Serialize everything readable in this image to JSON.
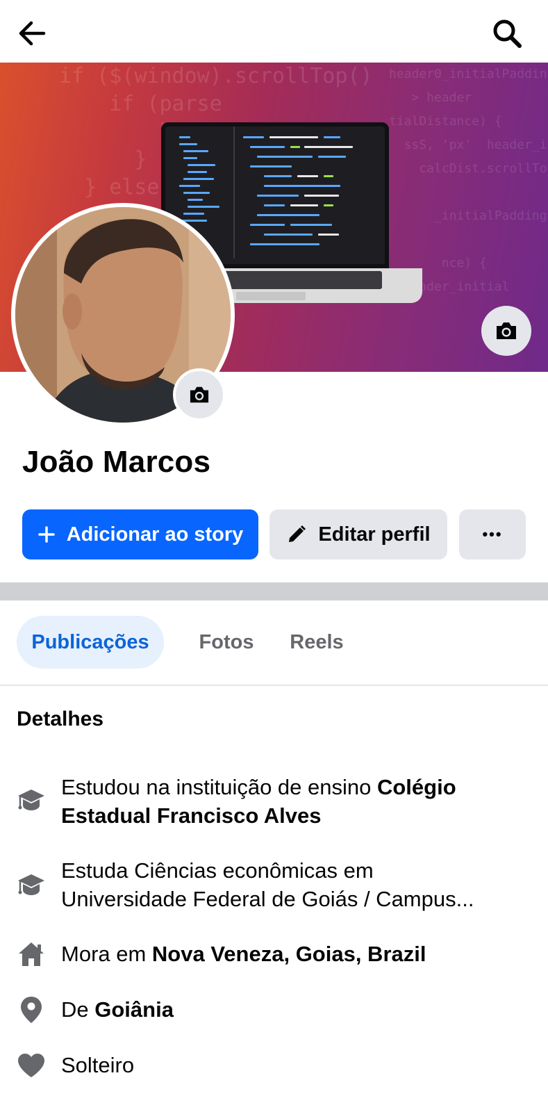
{
  "topbar": {
    "back_icon": "arrow-left-icon",
    "search_icon": "search-icon"
  },
  "profile": {
    "name": "João Marcos",
    "cover_camera_icon": "camera-icon",
    "avatar_camera_icon": "camera-icon"
  },
  "actions": {
    "add_story_label": "Adicionar ao story",
    "add_story_icon": "plus-icon",
    "edit_profile_label": "Editar perfil",
    "edit_profile_icon": "pencil-icon",
    "more_label": "•••"
  },
  "tabs": [
    {
      "label": "Publicações",
      "active": true
    },
    {
      "label": "Fotos",
      "active": false
    },
    {
      "label": "Reels",
      "active": false
    }
  ],
  "details": {
    "title": "Detalhes",
    "items": [
      {
        "icon": "graduation-cap-icon",
        "prefix": "Estudou na instituição de ensino ",
        "bold": "Colégio Estadual Francisco Alves"
      },
      {
        "icon": "graduation-cap-icon",
        "line1": "Estuda Ciências econômicas em",
        "line2": "Universidade Federal de Goiás / Campus..."
      },
      {
        "icon": "home-icon",
        "prefix": "Mora em ",
        "bold": "Nova Veneza, Goias, Brazil"
      },
      {
        "icon": "location-pin-icon",
        "prefix": "De ",
        "bold": "Goiânia"
      },
      {
        "icon": "heart-icon",
        "text": "Solteiro"
      }
    ]
  },
  "colors": {
    "primary_button": "#0866ff",
    "secondary_button": "#e4e6eb",
    "active_tab_bg": "#e7f0fd",
    "active_tab_text": "#0a64d8",
    "icon_gray": "#65676b"
  }
}
